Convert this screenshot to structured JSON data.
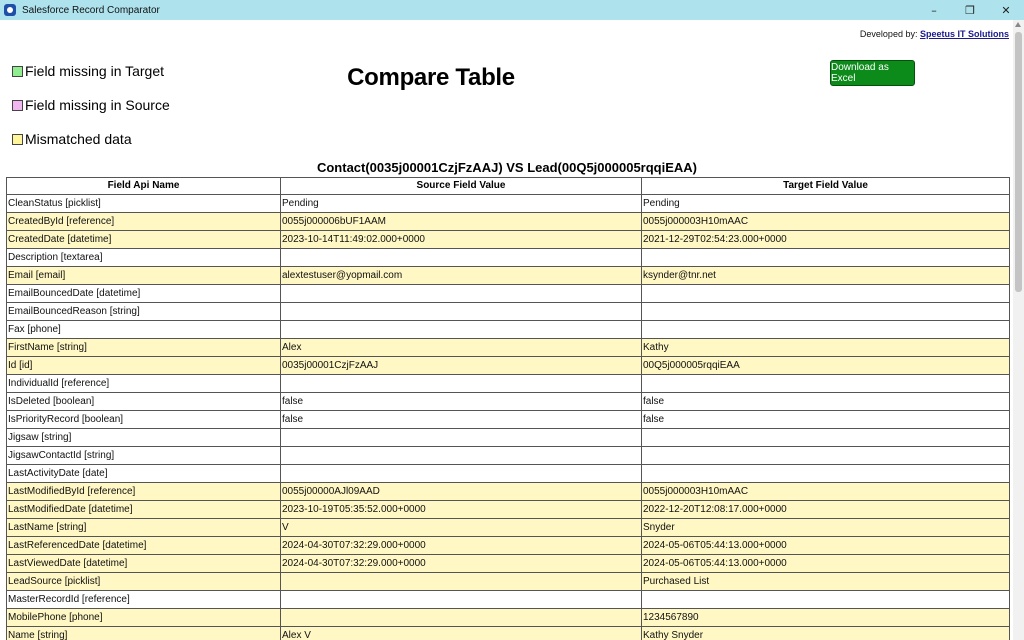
{
  "window": {
    "title": "Salesforce Record Comparator",
    "minimize": "–",
    "restore": "❐",
    "close": "✕"
  },
  "developer": {
    "prefix": "Developed by:",
    "link_text": "Speetus IT Solutions"
  },
  "legend": {
    "missing_target": "Field missing in Target",
    "missing_source": "Field missing in Source",
    "mismatched": "Mismatched data"
  },
  "page_title": "Compare Table",
  "download_button": "Download as Excel",
  "caption": "Contact(0035j00001CzjFzAAJ) VS Lead(00Q5j000005rqqiEAA)",
  "table": {
    "headers": [
      "Field Api Name",
      "Source Field Value",
      "Target Field Value"
    ],
    "rows": [
      {
        "field": "CleanStatus [picklist]",
        "source": "Pending",
        "target": "Pending",
        "status": "same"
      },
      {
        "field": "CreatedById [reference]",
        "source": "0055j000006bUF1AAM",
        "target": "0055j000003H10mAAC",
        "status": "mismatch"
      },
      {
        "field": "CreatedDate [datetime]",
        "source": "2023-10-14T11:49:02.000+0000",
        "target": "2021-12-29T02:54:23.000+0000",
        "status": "mismatch"
      },
      {
        "field": "Description [textarea]",
        "source": "",
        "target": "",
        "status": "same"
      },
      {
        "field": "Email [email]",
        "source": "alextestuser@yopmail.com",
        "target": "ksynder@tnr.net",
        "status": "mismatch"
      },
      {
        "field": "EmailBouncedDate [datetime]",
        "source": "",
        "target": "",
        "status": "same"
      },
      {
        "field": "EmailBouncedReason [string]",
        "source": "",
        "target": "",
        "status": "same"
      },
      {
        "field": "Fax [phone]",
        "source": "",
        "target": "",
        "status": "same"
      },
      {
        "field": "FirstName [string]",
        "source": "Alex",
        "target": "Kathy",
        "status": "mismatch"
      },
      {
        "field": "Id [id]",
        "source": "0035j00001CzjFzAAJ",
        "target": "00Q5j000005rqqiEAA",
        "status": "mismatch"
      },
      {
        "field": "IndividualId [reference]",
        "source": "",
        "target": "",
        "status": "same"
      },
      {
        "field": "IsDeleted [boolean]",
        "source": "false",
        "target": "false",
        "status": "same"
      },
      {
        "field": "IsPriorityRecord [boolean]",
        "source": "false",
        "target": "false",
        "status": "same"
      },
      {
        "field": "Jigsaw [string]",
        "source": "",
        "target": "",
        "status": "same"
      },
      {
        "field": "JigsawContactId [string]",
        "source": "",
        "target": "",
        "status": "same"
      },
      {
        "field": "LastActivityDate [date]",
        "source": "",
        "target": "",
        "status": "same"
      },
      {
        "field": "LastModifiedById [reference]",
        "source": "0055j00000AJl09AAD",
        "target": "0055j000003H10mAAC",
        "status": "mismatch"
      },
      {
        "field": "LastModifiedDate [datetime]",
        "source": "2023-10-19T05:35:52.000+0000",
        "target": "2022-12-20T12:08:17.000+0000",
        "status": "mismatch"
      },
      {
        "field": "LastName [string]",
        "source": "V",
        "target": "Snyder",
        "status": "mismatch"
      },
      {
        "field": "LastReferencedDate [datetime]",
        "source": "2024-04-30T07:32:29.000+0000",
        "target": "2024-05-06T05:44:13.000+0000",
        "status": "mismatch"
      },
      {
        "field": "LastViewedDate [datetime]",
        "source": "2024-04-30T07:32:29.000+0000",
        "target": "2024-05-06T05:44:13.000+0000",
        "status": "mismatch"
      },
      {
        "field": "LeadSource [picklist]",
        "source": "",
        "target": "Purchased List",
        "status": "mismatch"
      },
      {
        "field": "MasterRecordId [reference]",
        "source": "",
        "target": "",
        "status": "same"
      },
      {
        "field": "MobilePhone [phone]",
        "source": "",
        "target": "1234567890",
        "status": "mismatch"
      },
      {
        "field": "Name [string]",
        "source": "Alex V",
        "target": "Kathy Snyder",
        "status": "mismatch"
      }
    ]
  },
  "colors": {
    "titlebar": "#aee3ee",
    "missing_target": "#90ee90",
    "missing_source": "#f2b6f0",
    "mismatched": "#fff59a",
    "mismatch_row": "#fff7c4",
    "download_button": "#0c8a1a"
  }
}
